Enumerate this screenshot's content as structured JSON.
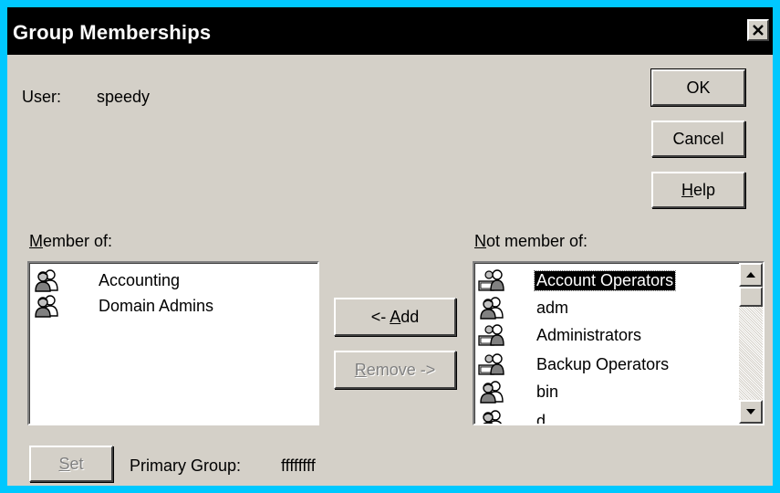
{
  "window": {
    "title": "Group Memberships",
    "close_label": "×"
  },
  "user": {
    "label": "User:",
    "value": "speedy"
  },
  "buttons": {
    "ok": "OK",
    "cancel": "Cancel",
    "help_accel": "H",
    "help_rest": "elp",
    "add_prefix": "<- ",
    "add_accel": "A",
    "add_rest": "dd",
    "remove_accel": "R",
    "remove_rest": "emove ->",
    "set_accel": "S",
    "set_rest": "et"
  },
  "member_of": {
    "label_accel": "M",
    "label_rest": "ember of:",
    "items": [
      {
        "label": "Accounting",
        "icon": "group-icon"
      },
      {
        "label": "Domain Admins",
        "icon": "group-icon"
      }
    ]
  },
  "not_member_of": {
    "label_accel": "N",
    "label_rest": "ot member of:",
    "items": [
      {
        "label": "Account Operators",
        "icon": "local-group-icon",
        "selected": true
      },
      {
        "label": "adm",
        "icon": "group-icon"
      },
      {
        "label": "Administrators",
        "icon": "local-group-icon"
      },
      {
        "label": "Backup Operators",
        "icon": "local-group-icon"
      },
      {
        "label": "bin",
        "icon": "group-icon"
      },
      {
        "label": "d",
        "icon": "group-icon"
      }
    ]
  },
  "primary_group": {
    "label": "Primary Group:",
    "value": "ffffffff"
  },
  "colors": {
    "desktop": "#00c8ff",
    "face": "#d4d0c8",
    "titlebar": "#000000",
    "selection": "#000000"
  }
}
